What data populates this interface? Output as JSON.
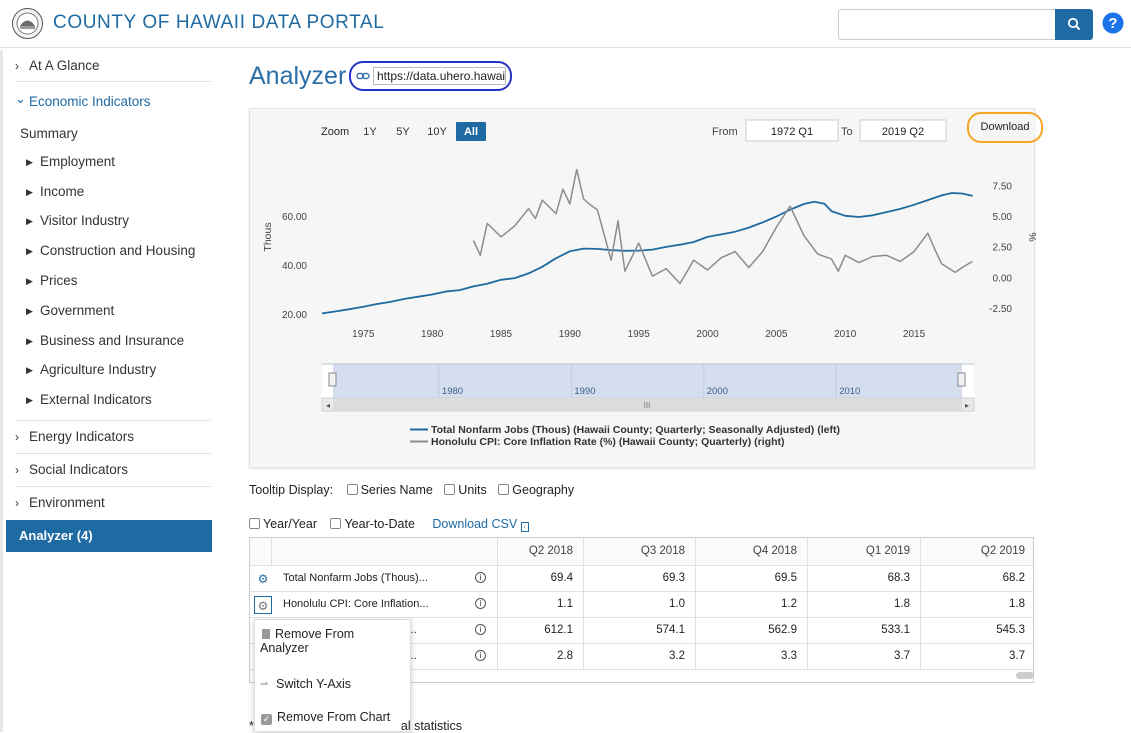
{
  "header": {
    "title": "COUNTY OF HAWAII DATA PORTAL",
    "search_placeholder": ""
  },
  "sidebar": {
    "top_items": [
      {
        "label": "At A Glance",
        "caret": "›"
      },
      {
        "label": "Economic Indicators",
        "caret": "⌄"
      }
    ],
    "summary": "Summary",
    "sub_items": [
      "Employment",
      "Income",
      "Visitor Industry",
      "Construction and Housing",
      "Prices",
      "Government",
      "Business and Insurance",
      "Agriculture Industry",
      "External Indicators"
    ],
    "bottom_items": [
      "Energy Indicators",
      "Social Indicators",
      "Environment"
    ],
    "analyzer": "Analyzer (4)"
  },
  "page": {
    "title": "Analyzer",
    "url": "https://data.uhero.hawaii.gov",
    "download": "Download"
  },
  "chart_controls": {
    "zoom_label": "Zoom",
    "zoom_options": [
      "1Y",
      "5Y",
      "10Y",
      "All"
    ],
    "zoom_active": "All",
    "from_label": "From",
    "from_value": "1972 Q1",
    "to_label": "To",
    "to_value": "2019 Q2"
  },
  "chart_data": {
    "type": "line",
    "xlim": [
      1972,
      2019.5
    ],
    "x_ticks": [
      "1975",
      "1980",
      "1985",
      "1990",
      "1995",
      "2000",
      "2005",
      "2010",
      "2015"
    ],
    "ylabel_left": "Thous",
    "ylim_left": [
      18,
      80
    ],
    "y_ticks_left": [
      "20.00",
      "40.00",
      "60.00"
    ],
    "ylabel_right": "%",
    "ylim_right": [
      -3.4,
      9.0
    ],
    "y_ticks_right": [
      "-2.50",
      "0.00",
      "2.50",
      "5.00",
      "7.50"
    ],
    "navigator_ticks": [
      "1980",
      "1990",
      "2000",
      "2010"
    ],
    "series": [
      {
        "name": "Total Nonfarm Jobs (Thous) (Hawaii County; Quarterly; Seasonally Adjusted) (left)",
        "axis": "left",
        "color": "#1f6a9e",
        "x": [
          1972,
          1973,
          1974,
          1975,
          1976,
          1977,
          1978,
          1979,
          1980,
          1981,
          1982,
          1983,
          1984,
          1985,
          1986,
          1987,
          1988,
          1989,
          1990,
          1991,
          1992,
          1993,
          1994,
          1995,
          1996,
          1997,
          1998,
          1999,
          2000,
          2001,
          2002,
          2003,
          2004,
          2005,
          2006,
          2007,
          2007.75,
          2008.5,
          2009,
          2010,
          2011,
          2012,
          2013,
          2014,
          2015,
          2016,
          2017,
          2017.75,
          2018.5,
          2019.25
        ],
        "y": [
          20.3,
          21.1,
          22.0,
          23.0,
          24.1,
          25.0,
          26.2,
          27.1,
          28.0,
          29.2,
          29.8,
          31.3,
          32.4,
          34.0,
          34.7,
          36.6,
          39.3,
          42.8,
          45.6,
          46.7,
          46.6,
          46.1,
          45.8,
          45.9,
          46.3,
          47.4,
          48.3,
          49.4,
          51.5,
          52.5,
          53.6,
          55.3,
          57.4,
          59.8,
          62.6,
          64.9,
          65.8,
          65.0,
          62.0,
          60.1,
          59.6,
          60.3,
          61.6,
          62.9,
          64.6,
          66.5,
          68.4,
          69.4,
          69.2,
          68.2
        ]
      },
      {
        "name": "Honolulu CPI: Core Inflation Rate (%) (Hawaii County; Quarterly) (right)",
        "axis": "right",
        "color": "#8c8c8c",
        "x": [
          1983,
          1983.5,
          1984,
          1985,
          1986,
          1987,
          1987.5,
          1988,
          1989,
          1989.5,
          1990,
          1990.5,
          1991,
          1991.5,
          1992,
          1993,
          1993.5,
          1994,
          1995,
          1996,
          1997,
          1998,
          1999,
          2000,
          2001,
          2002,
          2003,
          2004,
          2005,
          2006,
          2007,
          2008,
          2009,
          2009.5,
          2010,
          2011,
          2012,
          2013,
          2014,
          2015,
          2016,
          2016.5,
          2017,
          2018,
          2018.5,
          2019.25
        ],
        "y": [
          3.0,
          1.8,
          4.4,
          3.3,
          4.2,
          5.6,
          4.8,
          6.3,
          5.2,
          7.2,
          6.0,
          8.8,
          6.4,
          5.9,
          5.5,
          1.4,
          4.6,
          0.5,
          2.8,
          0.1,
          0.7,
          -0.5,
          1.4,
          0.6,
          1.6,
          2.1,
          0.8,
          2.1,
          4.1,
          5.8,
          3.4,
          1.9,
          1.5,
          0.5,
          1.8,
          1.2,
          1.7,
          1.8,
          1.3,
          2.1,
          3.6,
          2.3,
          1.1,
          0.4,
          0.8,
          1.3
        ]
      }
    ]
  },
  "tooltip": {
    "label": "Tooltip Display:",
    "options": [
      "Series Name",
      "Units",
      "Geography"
    ]
  },
  "table_options": {
    "yoy": "Year/Year",
    "ytd": "Year-to-Date",
    "csv": "Download CSV"
  },
  "table": {
    "columns": [
      "Q2 2018",
      "Q3 2018",
      "Q4 2018",
      "Q1 2019",
      "Q2 2019"
    ],
    "rows": [
      {
        "name": "Total Nonfarm Jobs (Thous)...",
        "values": [
          "69.4",
          "69.3",
          "69.5",
          "68.3",
          "68.2"
        ]
      },
      {
        "name": "Honolulu CPI: Core Inflation...",
        "values": [
          "1.1",
          "1.0",
          "1.2",
          "1.8",
          "1.8"
        ]
      },
      {
        "name": "itu...",
        "values": [
          "612.1",
          "574.1",
          "562.9",
          "533.1",
          "545.3"
        ]
      },
      {
        "name": "(H...",
        "values": [
          "2.8",
          "3.2",
          "3.3",
          "3.7",
          "3.7"
        ]
      }
    ]
  },
  "context_menu": {
    "remove_analyzer": "Remove From",
    "remove_analyzer_2": "Analyzer",
    "switch_axis": "Switch Y-Axis",
    "remove_chart": "Remove From Chart"
  },
  "footnote": {
    "star": "*",
    "text": "al statistics"
  }
}
